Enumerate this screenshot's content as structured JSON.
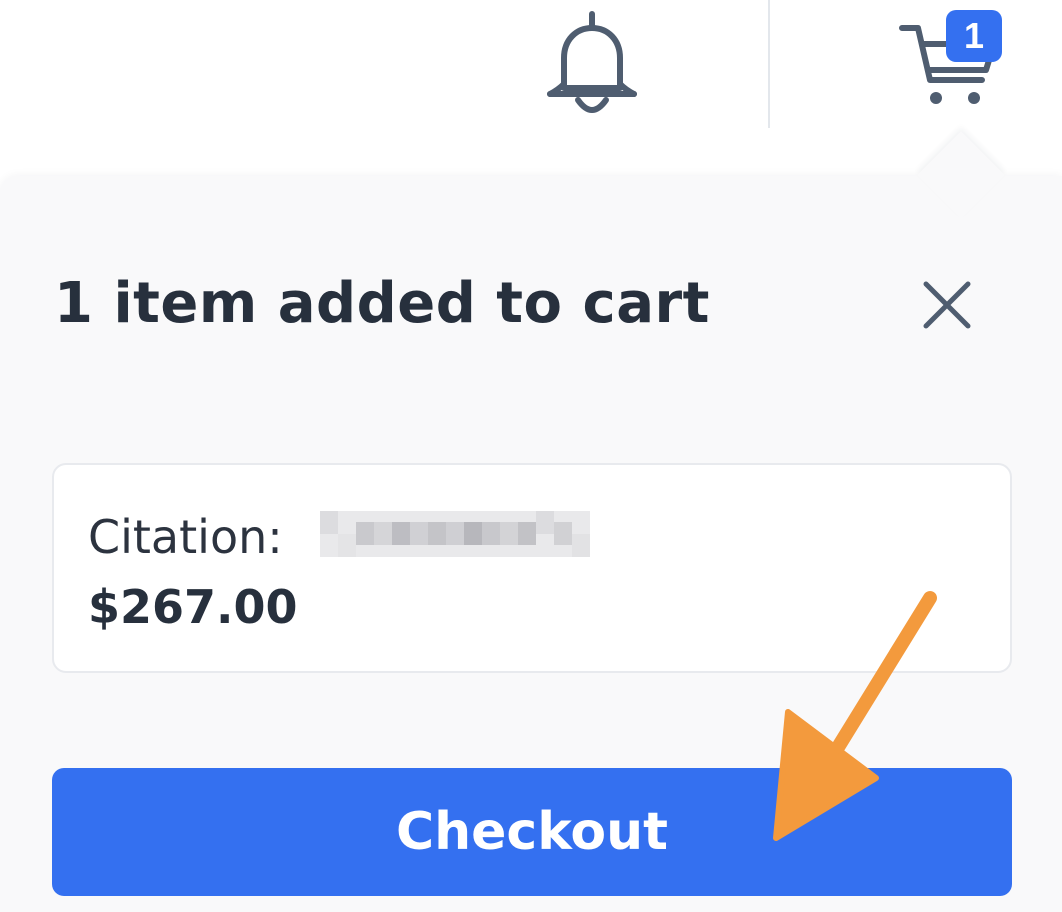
{
  "header": {
    "cart_badge_count": "1",
    "icons": [
      "bell-icon",
      "cart-icon"
    ]
  },
  "popover": {
    "title": "1 item added to cart",
    "close_icon": "close-icon",
    "item": {
      "citation_label": "Citation:",
      "price": "$267.00"
    },
    "checkout_label": "Checkout"
  },
  "colors": {
    "accent": "#3470f0",
    "text_dark": "#27303d",
    "icon_gray": "#4a5568",
    "panel_bg": "#f9f9fa",
    "annotation_arrow": "#f39a3d"
  }
}
